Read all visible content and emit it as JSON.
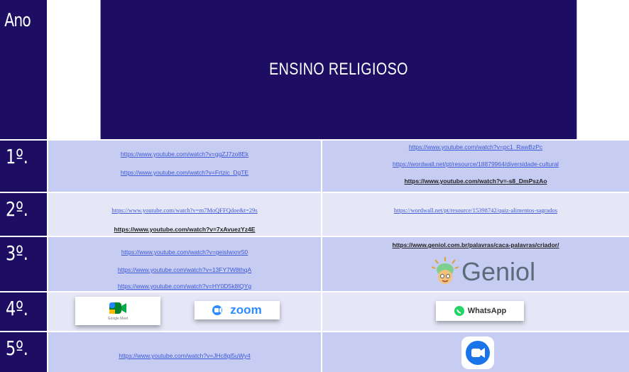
{
  "header": {
    "ano": "Ano",
    "title": "ENSINO RELIGIOSO"
  },
  "rows": [
    {
      "year": "1º.",
      "left": [
        "https://www.youtube.com/watch?v=ggZJ7zo8Ek",
        "https://www.youtube.com/watch?v=Frtzic_DgTE"
      ],
      "right": [
        "https://www.youtube.com/watch?v=pc1_RawBzPc",
        "https://wordwall.net/pt/resource/18879964/diversidade-cultural",
        "https://www.youtube.com/watch?v=-s8_DmPszAo"
      ]
    },
    {
      "year": "2º.",
      "left": [
        "https://www.youtube.com/watch?v=m7MoQFFQdoe&t=29s",
        "https://www.youtube.com/watch?v=7xAvuezYz4E"
      ],
      "right": [
        "https://wordwall.net/pt/resource/15398742/quiz-alimentos-sagrados"
      ]
    },
    {
      "year": "3º.",
      "left": [
        "https://www.youtube.com/watch?v=geisIwxnr50",
        "https://www.youtube.com/watch?v=13FY7W8thqA",
        "https://www.youtube.com/watch?v=HY0D5k8lQYg"
      ],
      "right": [
        "https://www.geniol.com.br/palavras/caca-palavras/criador/"
      ],
      "right_logo": "Geniol"
    },
    {
      "year": "4º.",
      "left_logos": [
        "Google Meet",
        "zoom"
      ],
      "right_logo": "WhatsApp"
    },
    {
      "year": "5º.",
      "left": [
        "https://www.youtube.com/watch?v=JHc8gl5uWy4"
      ],
      "right_icon": "google-duo-icon"
    }
  ],
  "colors": {
    "header": "#1d0e63",
    "row_dark": "#c7ccf2",
    "row_light": "#e5e7f7",
    "link": "#3d59d6"
  }
}
